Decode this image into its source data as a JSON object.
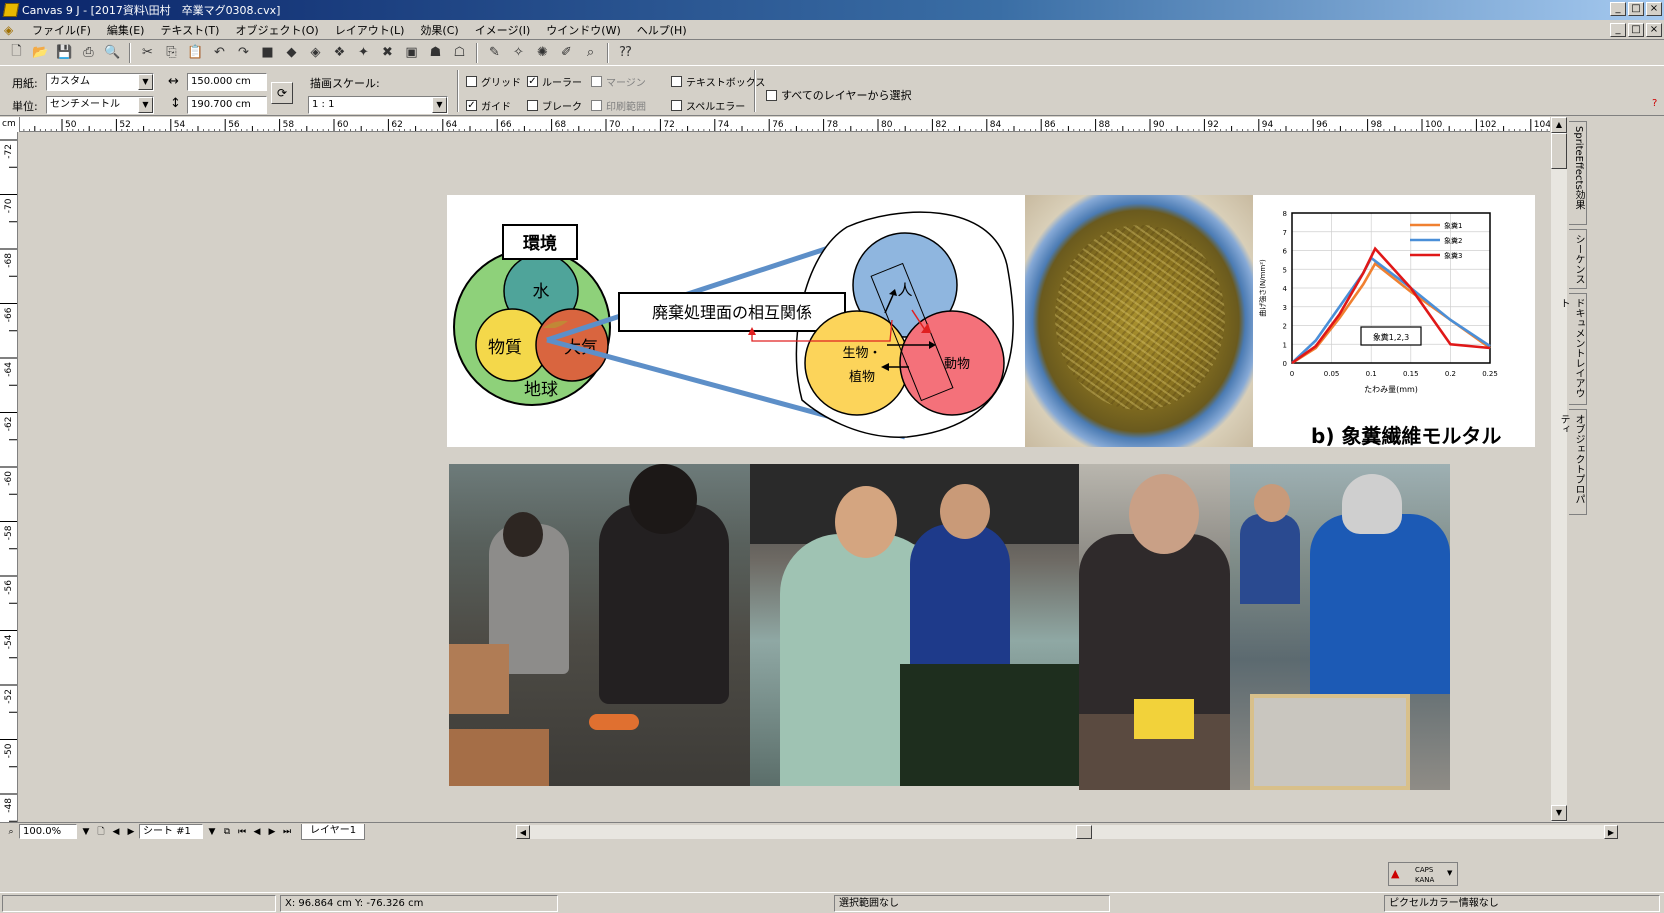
{
  "window": {
    "title": "Canvas 9 J - [2017資料\\田村　卒業マグ0308.cvx]",
    "min": "_",
    "max": "□",
    "close": "×"
  },
  "menu": [
    "ファイル(F)",
    "編集(E)",
    "テキスト(T)",
    "オブジェクト(O)",
    "レイアウト(L)",
    "効果(C)",
    "イメージ(I)",
    "ウインドウ(W)",
    "ヘルプ(H)"
  ],
  "propbar": {
    "paper_label": "用紙:",
    "paper_value": "カスタム",
    "unit_label": "単位:",
    "unit_value": "センチメートル",
    "width_value": "150.000 cm",
    "height_value": "190.700 cm",
    "scale_label": "描画スケール:",
    "scale_value": "1 : 1",
    "checks": {
      "grid": "グリッド",
      "ruler": "ルーラー",
      "margin": "マージン",
      "textbox": "テキストボックス",
      "guide": "ガイド",
      "break": "ブレーク",
      "print_area": "印刷範囲",
      "spell_error": "スペルエラー",
      "all_layers": "すべてのレイヤーから選択"
    },
    "help": "?"
  },
  "ruler": {
    "unit": "cm",
    "top_ticks": [
      "50",
      "52",
      "54",
      "56",
      "58",
      "60",
      "62",
      "64",
      "66",
      "68",
      "70",
      "72",
      "74",
      "76",
      "78",
      "80",
      "82",
      "84",
      "86",
      "88",
      "90",
      "92",
      "94",
      "96",
      "98",
      "100",
      "102",
      "104"
    ],
    "left_ticks": [
      "-72",
      "-70",
      "-68",
      "-66",
      "-64",
      "-62",
      "-60",
      "-58",
      "-56",
      "-54",
      "-52",
      "-50",
      "-48"
    ]
  },
  "side_tabs": [
    "SpriteEffects効果",
    "シーケンス",
    "ドキュメントレイアウト",
    "オブジェクトプロパティ"
  ],
  "bottom": {
    "zoom": "100.0%",
    "sheet": "シート #1",
    "layer": "レイヤー1",
    "caps": "CAPS",
    "kana": "KANA"
  },
  "status": {
    "coords": "X: 96.864 cm Y: -76.326 cm",
    "selection": "選択範囲なし",
    "pixel_info": "ピクセルカラー情報なし"
  },
  "figure": {
    "env_title": "環境",
    "water": "水",
    "matter": "物質",
    "air": "大気",
    "earth": "地球",
    "relation": "廃棄処理面の相互関係",
    "human": "人",
    "organism": "生物・",
    "plant": "植物",
    "animal": "動物",
    "caption": "b) 象糞繊維モルタル"
  },
  "chart_data": {
    "type": "line",
    "xlabel": "たわみ量(mm)",
    "ylabel": "曲げ強さ(N/mm²)",
    "xlim": [
      0,
      0.25
    ],
    "ylim": [
      0,
      8
    ],
    "x_ticks": [
      "0",
      "0.05",
      "0.1",
      "0.15",
      "0.2",
      "0.25"
    ],
    "y_ticks": [
      "0",
      "1",
      "2",
      "3",
      "4",
      "5",
      "6",
      "7",
      "8"
    ],
    "annotation": "象糞1,2,3",
    "legend": "top-right",
    "series": [
      {
        "name": "象糞1",
        "color": "#f08030",
        "points": [
          [
            0,
            0
          ],
          [
            0.03,
            0.8
          ],
          [
            0.06,
            2.4
          ],
          [
            0.09,
            4.2
          ],
          [
            0.105,
            5.3
          ],
          [
            0.15,
            3.8
          ],
          [
            0.2,
            2.3
          ],
          [
            0.25,
            0.8
          ]
        ]
      },
      {
        "name": "象糞2",
        "color": "#4a8fd8",
        "points": [
          [
            0,
            0
          ],
          [
            0.03,
            1.2
          ],
          [
            0.06,
            3.0
          ],
          [
            0.09,
            4.8
          ],
          [
            0.1,
            5.6
          ],
          [
            0.15,
            4.0
          ],
          [
            0.2,
            2.3
          ],
          [
            0.25,
            0.9
          ]
        ]
      },
      {
        "name": "象糞3",
        "color": "#e01818",
        "points": [
          [
            0,
            0
          ],
          [
            0.03,
            0.9
          ],
          [
            0.06,
            2.6
          ],
          [
            0.09,
            4.8
          ],
          [
            0.105,
            6.1
          ],
          [
            0.15,
            4.0
          ],
          [
            0.2,
            1.0
          ],
          [
            0.25,
            0.8
          ]
        ]
      }
    ]
  }
}
